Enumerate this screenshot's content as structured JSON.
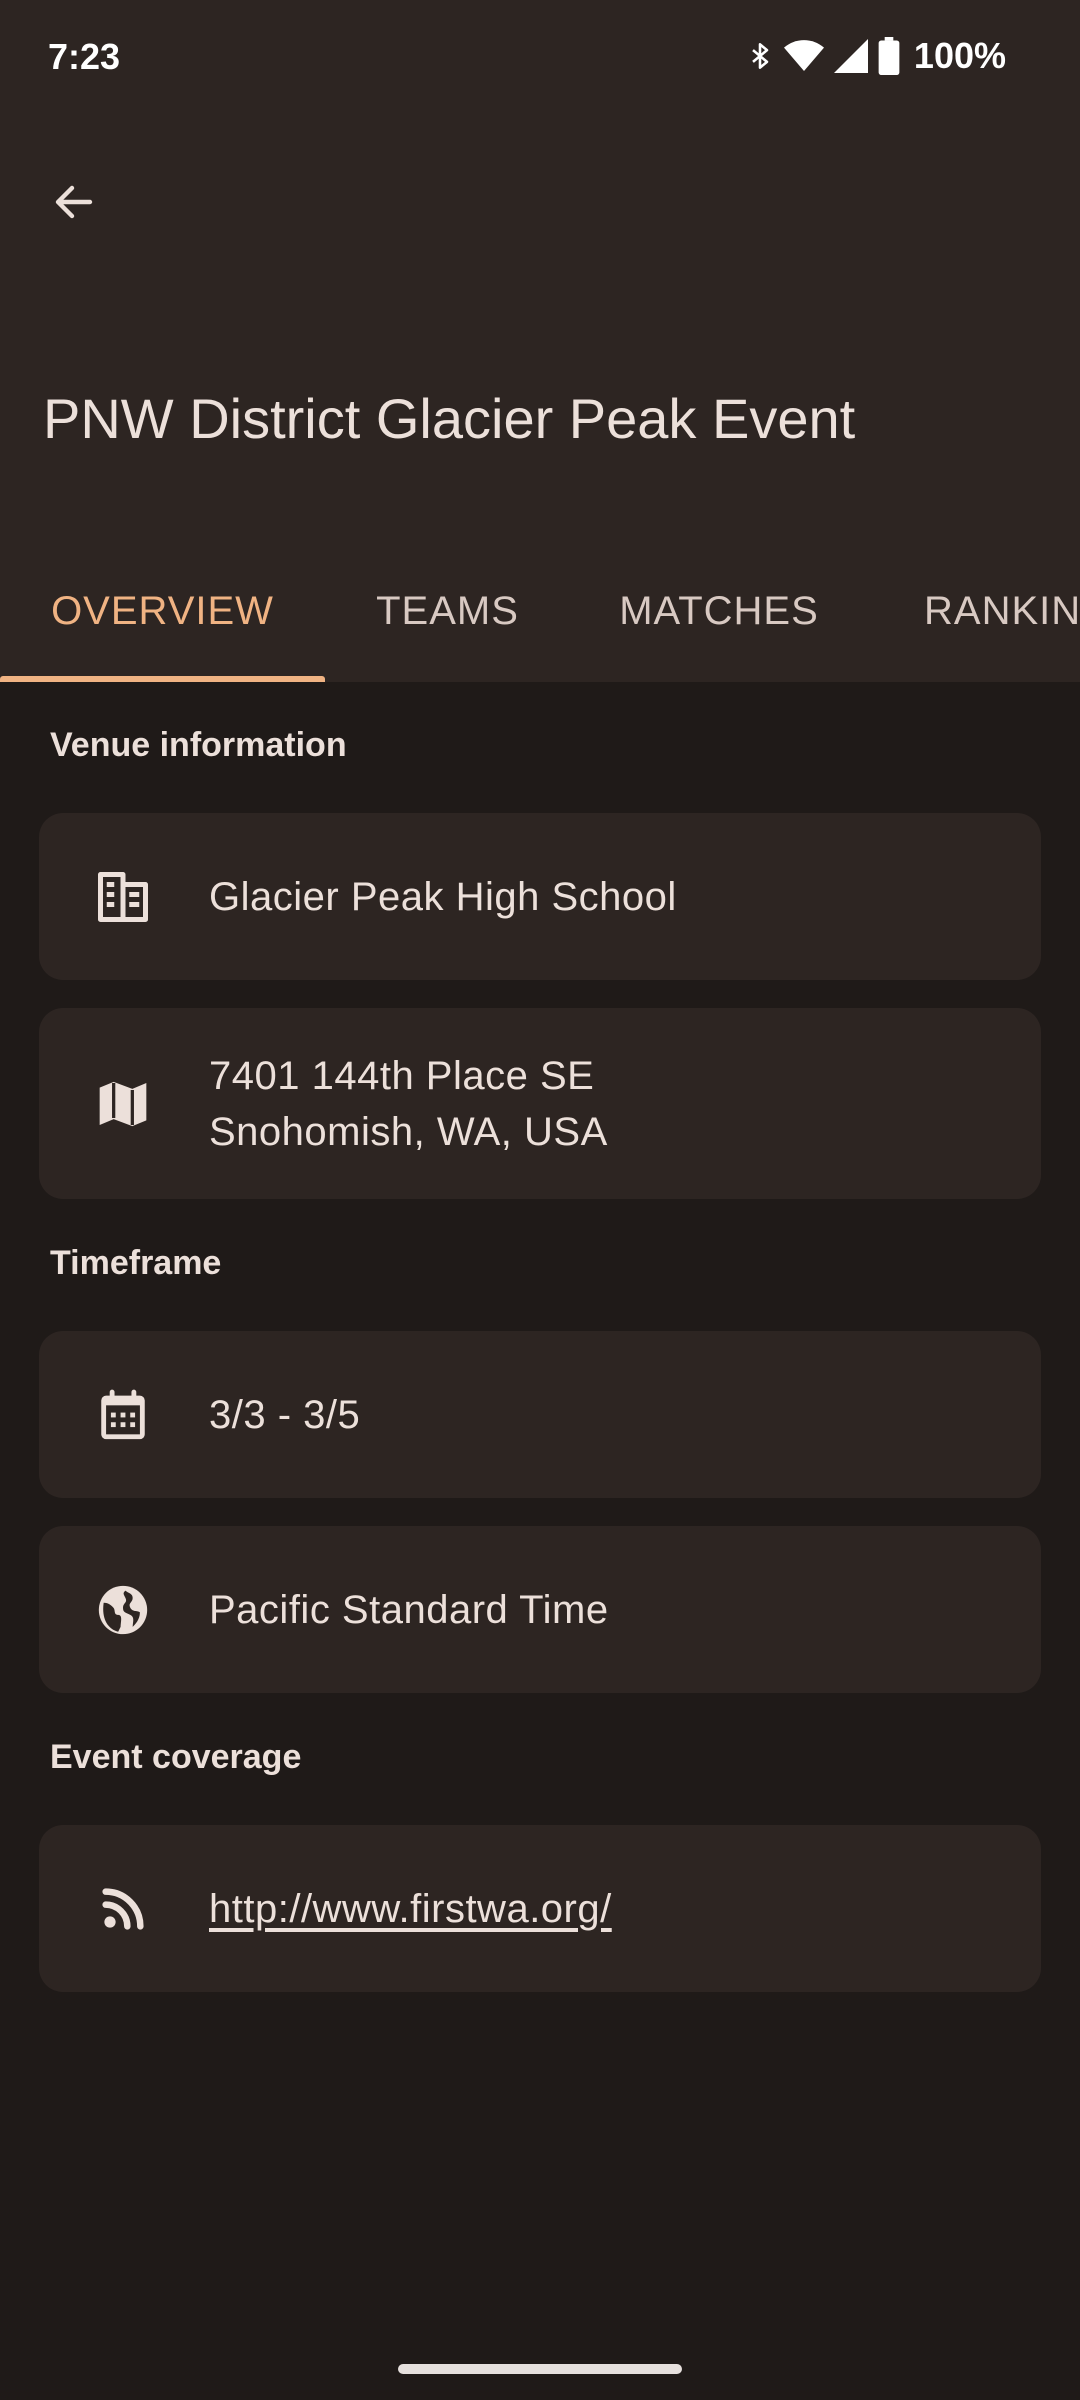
{
  "status_bar": {
    "time": "7:23",
    "battery": "100%",
    "icons": [
      "bluetooth-icon",
      "wifi-icon",
      "cell-signal-icon",
      "battery-icon"
    ]
  },
  "app_bar": {
    "back_icon": "arrow-back-icon",
    "title": "PNW District Glacier Peak Event"
  },
  "tabs": [
    {
      "label": "OVERVIEW",
      "active": true
    },
    {
      "label": "TEAMS",
      "active": false
    },
    {
      "label": "MATCHES",
      "active": false
    },
    {
      "label": "RANKINGS",
      "active": false
    }
  ],
  "sections": {
    "venue": {
      "header": "Venue information",
      "venue_name": "Glacier Peak High School",
      "address_line1": "7401 144th Place SE",
      "address_line2": "Snohomish, WA, USA"
    },
    "timeframe": {
      "header": "Timeframe",
      "dates": "3/3 - 3/5",
      "timezone": "Pacific Standard Time"
    },
    "coverage": {
      "header": "Event coverage",
      "url": "http://www.firstwa.org/"
    }
  },
  "colors": {
    "background": "#1f1a18",
    "surface": "#2d2522",
    "accent": "#f0b383",
    "text": "#ece0da"
  }
}
